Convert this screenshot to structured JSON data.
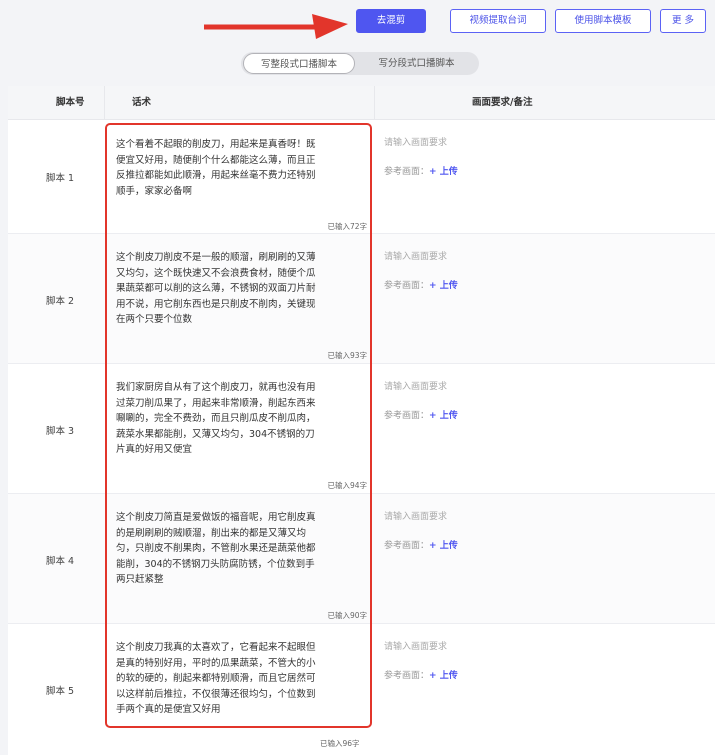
{
  "toolbar": {
    "buttons": [
      "去混剪",
      "视频提取台词",
      "使用脚本模板",
      "更 多"
    ],
    "accent": "#4f56f0",
    "arrow_color": "#e2352b"
  },
  "switch": {
    "options": [
      "写整段式口播脚本",
      "写分段式口播脚本"
    ],
    "active": 0
  },
  "table": {
    "headers": [
      "脚本号",
      "话术",
      "画面要求/备注"
    ],
    "rows": [
      {
        "label": "脚本 1",
        "text": "这个看着不起眼的削皮刀，用起来是真香呀！既\n便宜又好用，随便削个什么都能这么薄，而且正\n反推拉都能如此顺滑，用起来丝毫不费力还特别\n顺手，家家必备啊",
        "count": "已输入72字",
        "placeholder": "请输入画面要求",
        "ref_label": "参考画面：",
        "upload": "+ 上传"
      },
      {
        "label": "脚本 2",
        "text": "这个削皮刀削皮不是一般的顺溜，刷刷刷的又薄\n又均匀，这个既快速又不会浪费食材，随便个瓜\n果蔬菜都可以削的这么薄，不锈钢的双面刀片耐\n用不说，用它削东西也是只削皮不削肉，关键现\n在两个只要个位数",
        "count": "已输入93字",
        "placeholder": "请输入画面要求",
        "ref_label": "参考画面：",
        "upload": "+ 上传"
      },
      {
        "label": "脚本 3",
        "text": "我们家厨房自从有了这个削皮刀，就再也没有用\n过菜刀削瓜果了，用起来非常顺滑，削起东西来\n唰唰的，完全不费劲，而且只削瓜皮不削瓜肉，\n蔬菜水果都能削，又薄又均匀，304不锈钢的刀\n片真的好用又便宜",
        "count": "已输入94字",
        "placeholder": "请输入画面要求",
        "ref_label": "参考画面：",
        "upload": "+ 上传"
      },
      {
        "label": "脚本 4",
        "text": "这个削皮刀简直是爱做饭的福音呢，用它削皮真\n的是刷刷刷的贼顺溜，削出来的都是又薄又均\n匀，只削皮不削果肉，不管削水果还是蔬菜他都\n能削，304的不锈钢刀头防腐防锈，个位数到手\n两只赶紧整",
        "count": "已输入90字",
        "placeholder": "请输入画面要求",
        "ref_label": "参考画面：",
        "upload": "+ 上传"
      },
      {
        "label": "脚本 5",
        "text": "这个削皮刀我真的太喜欢了，它看起来不起眼但\n是真的特别好用，平时的瓜果蔬菜，不管大的小\n的软的硬的，削起来都特别顺滑，而且它居然可\n以这样前后推拉，不仅很薄还很均匀，个位数到\n手两个真的是便宜又好用",
        "count": "已输入96字",
        "placeholder": "请输入画面要求",
        "ref_label": "参考画面：",
        "upload": "+ 上传"
      }
    ]
  }
}
